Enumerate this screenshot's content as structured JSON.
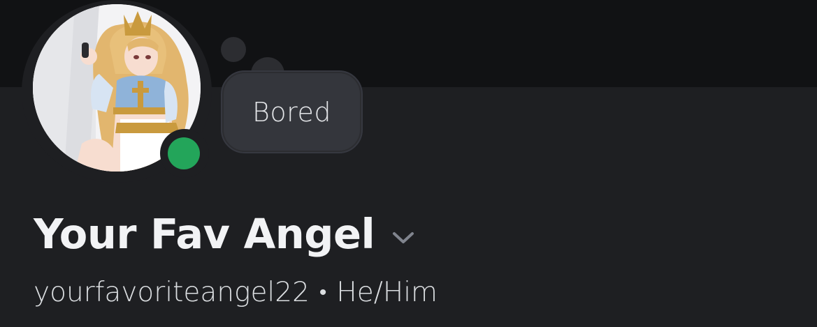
{
  "profile": {
    "custom_status": "Bored",
    "display_name": "Your Fav Angel",
    "username": "yourfavoriteangel22",
    "separator": "•",
    "pronouns": "He/Him",
    "online_status": "online"
  },
  "icons": {
    "avatar": "anime-character-avatar",
    "status": "online-status-dot",
    "expand": "chevron-down-icon"
  },
  "colors": {
    "banner": "#111214",
    "background": "#1e1f22",
    "bubble": "#34363c",
    "online": "#23a55a",
    "text_primary": "#f2f3f5",
    "text_secondary": "#dbdee1"
  }
}
